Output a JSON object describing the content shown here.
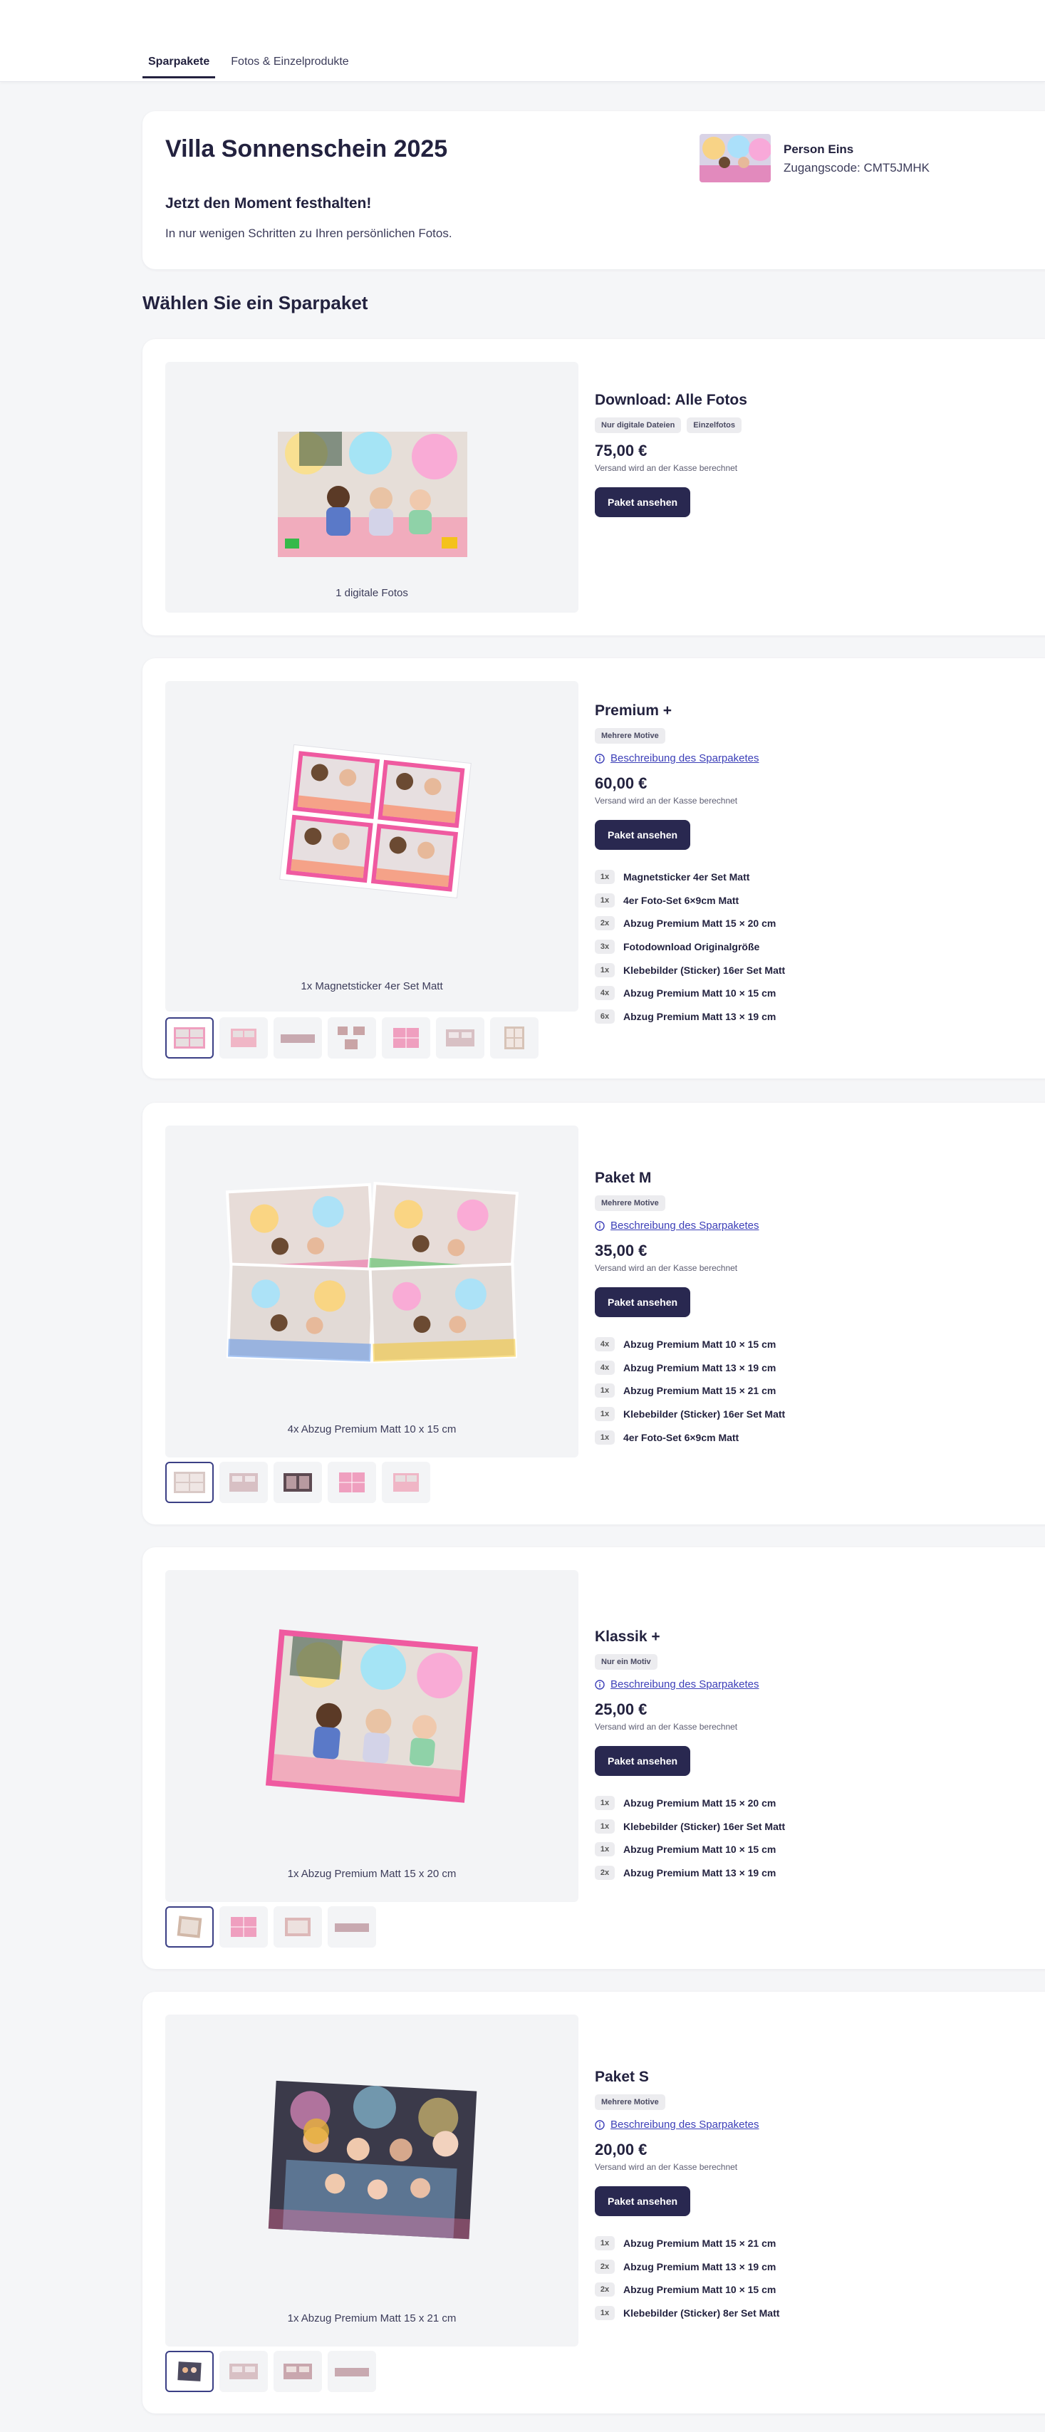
{
  "tabs": [
    "Sparpakete",
    "Fotos & Einzelprodukte"
  ],
  "event": {
    "title": "Villa Sonnenschein 2025",
    "subtitle": "Jetzt den Moment festhalten!",
    "description": "In nur wenigen Schritten zu Ihren persönlichen Fotos.",
    "person_name": "Person Eins",
    "access_code": "Zugangscode: CMT5JMHK"
  },
  "section_title": "Wählen Sie ein Sparpaket",
  "colors": {
    "primary": "#292850",
    "link": "#3c3fb8",
    "accent_frame": "#e4509a"
  },
  "common": {
    "view_button": "Paket ansehen",
    "shipping_note": "Versand wird an der Kasse berechnet",
    "description_link": "Beschreibung des Sparpaketes"
  },
  "packages": [
    {
      "title": "Download: Alle Fotos",
      "badges": [
        "Nur digitale Dateien",
        "Einzelfotos"
      ],
      "price": "75,00 €",
      "caption": "1 digitale Fotos",
      "has_description_link": false,
      "items": [],
      "thumb_count": 0
    },
    {
      "title": "Premium +",
      "badges": [
        "Mehrere Motive"
      ],
      "price": "60,00 €",
      "caption": "1x Magnetsticker 4er Set Matt",
      "has_description_link": true,
      "items": [
        {
          "qty": "1x",
          "label": "Magnetsticker 4er Set Matt"
        },
        {
          "qty": "1x",
          "label": "4er Foto-Set 6×9cm Matt"
        },
        {
          "qty": "2x",
          "label": "Abzug Premium Matt 15 × 20 cm"
        },
        {
          "qty": "3x",
          "label": "Fotodownload Originalgröße"
        },
        {
          "qty": "1x",
          "label": "Klebebilder (Sticker) 16er Set Matt"
        },
        {
          "qty": "4x",
          "label": "Abzug Premium Matt 10 × 15 cm"
        },
        {
          "qty": "6x",
          "label": "Abzug Premium Matt 13 × 19 cm"
        }
      ],
      "thumb_count": 7
    },
    {
      "title": "Paket M",
      "badges": [
        "Mehrere Motive"
      ],
      "price": "35,00 €",
      "caption": "4x Abzug Premium Matt 10 x 15 cm",
      "has_description_link": true,
      "items": [
        {
          "qty": "4x",
          "label": "Abzug Premium Matt 10 × 15 cm"
        },
        {
          "qty": "4x",
          "label": "Abzug Premium Matt 13 × 19 cm"
        },
        {
          "qty": "1x",
          "label": "Abzug Premium Matt 15 × 21 cm"
        },
        {
          "qty": "1x",
          "label": "Klebebilder (Sticker) 16er Set Matt"
        },
        {
          "qty": "1x",
          "label": "4er Foto-Set 6×9cm Matt"
        }
      ],
      "thumb_count": 5
    },
    {
      "title": "Klassik +",
      "badges": [
        "Nur ein Motiv"
      ],
      "price": "25,00 €",
      "caption": "1x Abzug Premium Matt 15 x 20 cm",
      "has_description_link": true,
      "items": [
        {
          "qty": "1x",
          "label": "Abzug Premium Matt 15 × 20 cm"
        },
        {
          "qty": "1x",
          "label": "Klebebilder (Sticker) 16er Set Matt"
        },
        {
          "qty": "1x",
          "label": "Abzug Premium Matt 10 × 15 cm"
        },
        {
          "qty": "2x",
          "label": "Abzug Premium Matt 13 × 19 cm"
        }
      ],
      "thumb_count": 4
    },
    {
      "title": "Paket S",
      "badges": [
        "Mehrere Motive"
      ],
      "price": "20,00 €",
      "caption": "1x Abzug Premium Matt 15 x 21 cm",
      "has_description_link": true,
      "items": [
        {
          "qty": "1x",
          "label": "Abzug Premium Matt 15 × 21 cm"
        },
        {
          "qty": "2x",
          "label": "Abzug Premium Matt 13 × 19 cm"
        },
        {
          "qty": "2x",
          "label": "Abzug Premium Matt 10 × 15 cm"
        },
        {
          "qty": "1x",
          "label": "Klebebilder (Sticker) 8er Set Matt"
        }
      ],
      "thumb_count": 4
    }
  ]
}
